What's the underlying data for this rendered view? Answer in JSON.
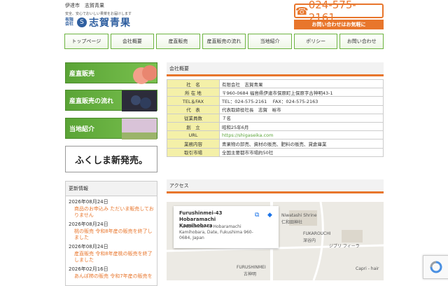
{
  "header": {
    "top_text": "伊達市　志賀青果",
    "tagline": "安全、安心でおいしい果菜をお届けします",
    "logo_kaisha": "有限会社",
    "logo_name": "志賀青果",
    "phone": "024-575-2161",
    "phone_cta": "お問い合わせはお気軽に"
  },
  "nav": [
    "トップページ",
    "会社概要",
    "産直販売",
    "産直販売の流れ",
    "当地紹介",
    "ポリシー",
    "お問い合わせ"
  ],
  "sidebar": {
    "banners": [
      "産直販売",
      "産直販売の流れ",
      "当地紹介"
    ],
    "fukushima": "ふくしま新発売。",
    "news_title": "更新情報",
    "news": [
      {
        "date": "2026年08月24日",
        "text": "商品のお申込み ただいま販売しておりません"
      },
      {
        "date": "2026年08月24日",
        "text": "桃の販売 令和8年産の販売を終了しました"
      },
      {
        "date": "2026年08月24日",
        "text": "産直販売 令和8年産桃の販売を終了しました"
      },
      {
        "date": "2026年02月16日",
        "text": "あんぽ柿の販売 令和7年産の販売を"
      }
    ]
  },
  "company": {
    "title": "会社概要",
    "rows": [
      {
        "key": "社　名",
        "value": "有限会社　志賀青果"
      },
      {
        "key": "所 在 地",
        "value": "〒960-0684 福島県伊達市保原町上保原字古神明43-1"
      },
      {
        "key": "TEL＆FAX",
        "value": "TEL：024-575-2161　 FAX：024-575-2163"
      },
      {
        "key": "代　表",
        "value": "代表取締役社長　志賀　裕市"
      },
      {
        "key": "従業員数",
        "value": "７名"
      },
      {
        "key": "創　立",
        "value": "昭和25年6月"
      },
      {
        "key": "URL",
        "value": "https://shigaseika.com"
      },
      {
        "key": "業務内容",
        "value": "青果物の卸売、資材の販売、肥料の販売、貸倉庫業"
      },
      {
        "key": "取引市場",
        "value": "全国主要都市市場約50社"
      }
    ]
  },
  "access": {
    "title": "アクセス",
    "map_name": "Furushinmei-43 Hobaramachi Kamihobara",
    "map_addr": "Furushinmei-43 Hobaramachi Kamihobara, Date, Fukushima 960-0684, Japan",
    "labels": [
      "Niwatashi Shrine",
      "仁和田神社",
      "FUKAROUCHI",
      "深谷内",
      "ジブリ フィーラ",
      "FURUSHINMEI",
      "古神明",
      "Capri - hair"
    ]
  }
}
